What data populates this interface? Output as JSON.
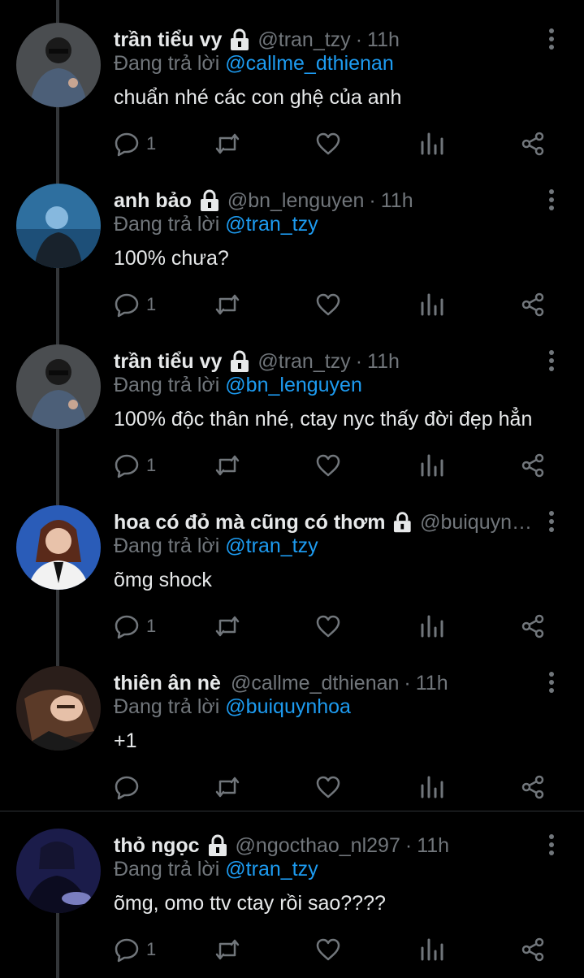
{
  "replying_prefix": "Đang trả lời",
  "tweets": [
    {
      "name": "trần tiểu vy",
      "handle": "@tran_tzy",
      "time": "11h",
      "reply_to": "@callme_dthienan",
      "text": "chuẩn nhé các con ghệ của anh",
      "replies": "1"
    },
    {
      "name": "anh bảo",
      "handle": "@bn_lenguyen",
      "time": "11h",
      "reply_to": "@tran_tzy",
      "text": "100% chưa?",
      "replies": "1"
    },
    {
      "name": "trần tiểu vy",
      "handle": "@tran_tzy",
      "time": "11h",
      "reply_to": "@bn_lenguyen",
      "text": "100% độc thân nhé, ctay nyc thấy đời đẹp hẳn",
      "replies": "1"
    },
    {
      "name": "hoa có đỏ mà cũng có thơm",
      "handle": "@buiquynh…",
      "time": "",
      "reply_to": "@tran_tzy",
      "text": "õmg shock",
      "replies": "1"
    },
    {
      "name": "thiên ân nè",
      "handle": "@callme_dthienan",
      "time": "11h",
      "reply_to": "@buiquynhoa",
      "text": "+1",
      "replies": ""
    },
    {
      "name": "thỏ ngọc",
      "handle": "@ngocthao_nl297",
      "time": "11h",
      "reply_to": "@tran_tzy",
      "text": "õmg, omo ttv ctay rồi sao????",
      "replies": "1"
    }
  ],
  "icons": {
    "reply": "reply-icon",
    "retweet": "retweet-icon",
    "like": "heart-icon",
    "views": "analytics-icon",
    "share": "share-icon",
    "lock": "lock-icon",
    "more": "more-vertical-icon"
  },
  "colors": {
    "background": "#000000",
    "text": "#e7e9ea",
    "muted": "#71767b",
    "link": "#1d9bf0",
    "line": "#333639"
  }
}
